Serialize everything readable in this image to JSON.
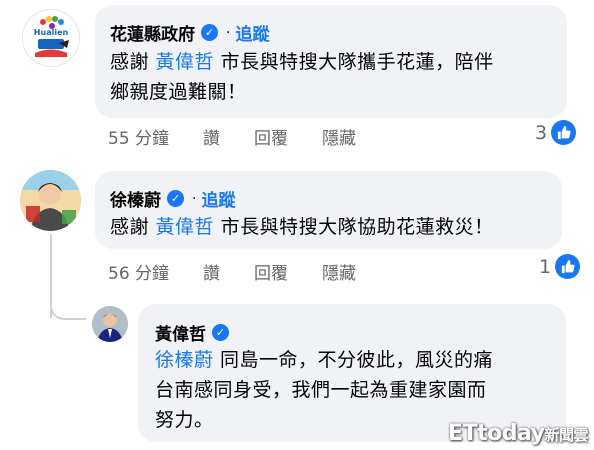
{
  "colors": {
    "accent": "#1877f2",
    "bubble": "#f0f2f5",
    "meta_text": "#65676b"
  },
  "comments": [
    {
      "author": "花蓮縣政府",
      "avatar_icon": "hualien-county-logo",
      "avatar_text": "Hualien",
      "follow": "追蹤",
      "text_lines": [
        {
          "before": "感謝 ",
          "mention": "黃偉哲",
          "after": " 市長與特搜大隊攜手花蓮，陪伴"
        },
        {
          "before": "鄉親度過難關！",
          "mention": "",
          "after": ""
        }
      ],
      "time": "55 分鐘",
      "like": "讚",
      "reply": "回覆",
      "hide": "隱藏",
      "reaction_count": "3"
    },
    {
      "author": "徐榛蔚",
      "avatar_icon": "person-photo",
      "follow": "追蹤",
      "text_lines": [
        {
          "before": "感謝 ",
          "mention": "黃偉哲",
          "after": " 市長與特搜大隊協助花蓮救災！"
        }
      ],
      "time": "56 分鐘",
      "like": "讚",
      "reply": "回覆",
      "hide": "隱藏",
      "reaction_count": "1"
    }
  ],
  "reply": {
    "author": "黃偉哲",
    "avatar_icon": "person-photo",
    "text_lines": [
      {
        "before": "",
        "mention": "徐榛蔚",
        "after": " 同島一命，不分彼此，風災的痛"
      },
      {
        "before": "台南感同身受，我們一起為重建家園而",
        "mention": "",
        "after": ""
      },
      {
        "before": "努力。",
        "mention": "",
        "after": ""
      }
    ]
  },
  "watermark": {
    "brand": "ETtoday",
    "suffix": "新聞雲"
  }
}
